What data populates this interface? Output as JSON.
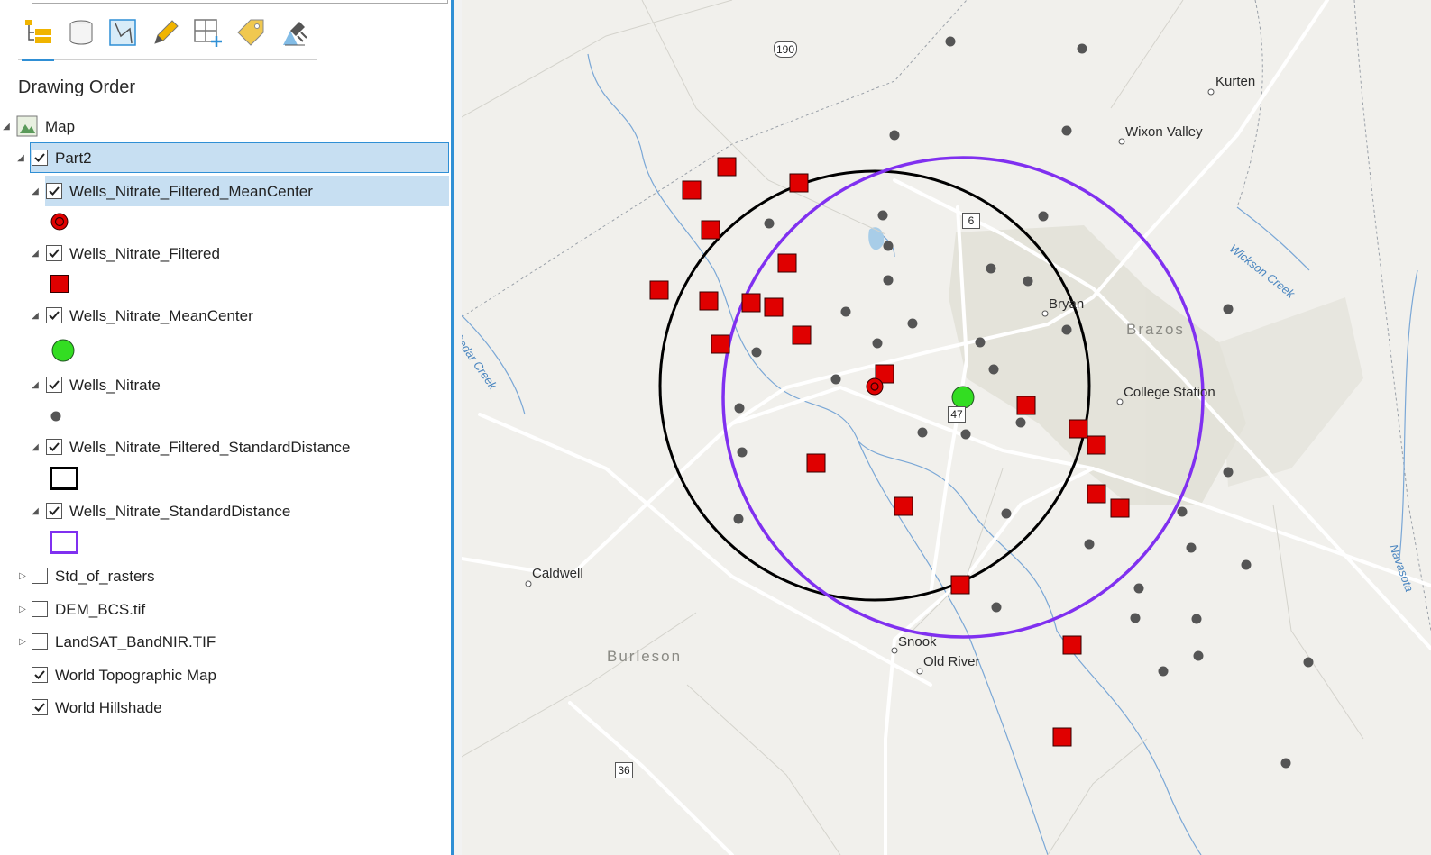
{
  "toolbar": {
    "tools": [
      {
        "name": "list-by-drawing-order-icon",
        "active": true
      },
      {
        "name": "list-by-data-source-icon",
        "active": false
      },
      {
        "name": "list-by-selection-icon",
        "active": false
      },
      {
        "name": "list-by-editing-icon",
        "active": false
      },
      {
        "name": "list-by-snapping-icon",
        "active": false
      },
      {
        "name": "list-by-labeling-icon",
        "active": false
      },
      {
        "name": "list-by-perspective-imagery-icon",
        "active": false
      }
    ]
  },
  "panel": {
    "title": "Drawing Order"
  },
  "toc": {
    "map": {
      "label": "Map"
    },
    "part2": {
      "label": "Part2",
      "checked": true
    },
    "layers": [
      {
        "label": "Wells_Nitrate_Filtered_MeanCenter",
        "checked": true,
        "symbol": "red-ring-point"
      },
      {
        "label": "Wells_Nitrate_Filtered",
        "checked": true,
        "symbol": "red-square"
      },
      {
        "label": "Wells_Nitrate_MeanCenter",
        "checked": true,
        "symbol": "green-circle"
      },
      {
        "label": "Wells_Nitrate",
        "checked": true,
        "symbol": "gray-dot"
      },
      {
        "label": "Wells_Nitrate_Filtered_StandardDistance",
        "checked": true,
        "symbol": "black-outline"
      },
      {
        "label": "Wells_Nitrate_StandardDistance",
        "checked": true,
        "symbol": "purple-outline"
      }
    ],
    "collapsed": [
      {
        "label": "Std_of_rasters",
        "checked": false
      },
      {
        "label": "DEM_BCS.tif",
        "checked": false
      },
      {
        "label": "LandSAT_BandNIR.TIF",
        "checked": false
      }
    ],
    "basemaps": [
      {
        "label": "World Topographic Map",
        "checked": true
      },
      {
        "label": "World Hillshade",
        "checked": true
      }
    ]
  },
  "map": {
    "places": [
      "Kurten",
      "Wixon Valley",
      "Bryan",
      "College Station",
      "Caldwell",
      "Snook",
      "Old River"
    ],
    "counties": [
      "Brazos",
      "Burleson"
    ],
    "waters": [
      "Wickson Creek",
      "Cedar Creek",
      "Navasota"
    ],
    "shields": [
      "190",
      "6",
      "47",
      "36"
    ],
    "colors": {
      "filtered_wells": "#e00000",
      "mean_center": "#33dd22",
      "wells": "#555555",
      "filtered_std_distance": "#000000",
      "std_distance": "#8030f0"
    }
  }
}
